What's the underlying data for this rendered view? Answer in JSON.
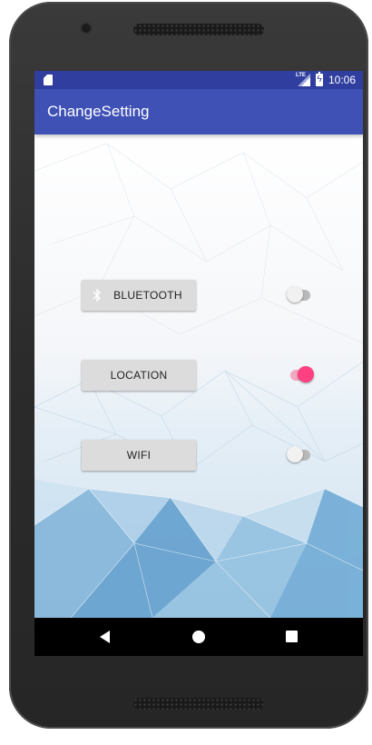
{
  "status_bar": {
    "network": "LTE",
    "time": "10:06",
    "icons": [
      "sd-card-icon",
      "lte-signal-icon",
      "battery-charging-icon"
    ]
  },
  "app_bar": {
    "title": "ChangeSetting"
  },
  "settings": [
    {
      "label": "BLUETOOTH",
      "icon": "bluetooth-icon",
      "switch_on": false
    },
    {
      "label": "LOCATION",
      "icon": null,
      "switch_on": true
    },
    {
      "label": "WIFI",
      "icon": null,
      "switch_on": false
    }
  ],
  "nav_bar": {
    "icons": [
      "back-icon",
      "home-icon",
      "recents-icon"
    ]
  },
  "colors": {
    "status_bar": "#303f9f",
    "app_bar": "#3f51b5",
    "accent": "#ff4081",
    "button": "#dcdcdc"
  }
}
